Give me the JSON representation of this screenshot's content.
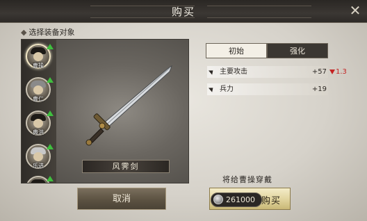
{
  "window": {
    "title": "购买"
  },
  "section_label": "选择装备对象",
  "heroes": [
    {
      "name": "曹操",
      "selected": true
    },
    {
      "name": "曹仁",
      "selected": false
    },
    {
      "name": "典洪",
      "selected": false
    },
    {
      "name": "乐进",
      "selected": false
    },
    {
      "name": "",
      "selected": false
    }
  ],
  "weapon": {
    "name": "风霁剑"
  },
  "tabs": [
    {
      "label": "初始",
      "active": true
    },
    {
      "label": "强化",
      "active": false
    }
  ],
  "stats": [
    {
      "label": "主要攻击",
      "value": "+57",
      "diff": "1.3"
    },
    {
      "label": "兵力",
      "value": "+19"
    }
  ],
  "give_label": "将给曹操穿戴",
  "buttons": {
    "cancel": "取消",
    "buy": "购买",
    "price": "261000"
  },
  "icons": {
    "close": "close-icon",
    "coin": "silver-coin-icon",
    "stat_cursor": "pointer-icon",
    "upgrade_arrow": "green-up-arrow-icon",
    "decrease": "red-down-triangle-icon"
  },
  "colors": {
    "increase": "#3fbf3f",
    "decrease": "#c42323",
    "accent": "#e0d39c"
  }
}
